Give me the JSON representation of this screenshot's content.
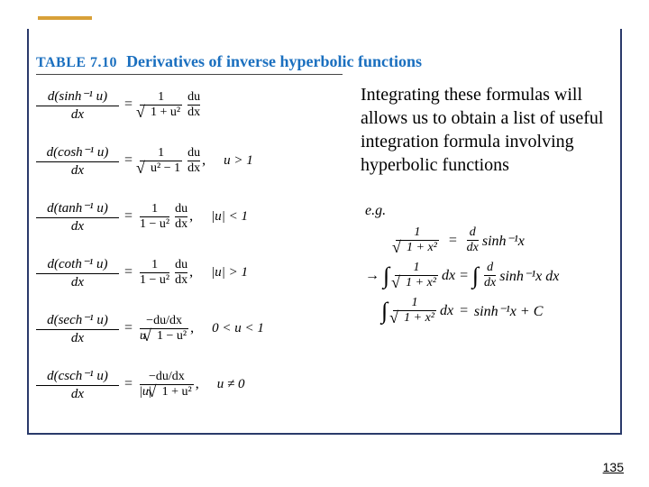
{
  "accent": {},
  "table": {
    "label": "TABLE 7.10",
    "title": "Derivatives of inverse hyperbolic functions"
  },
  "formulas": [
    {
      "lhs_num": "d(sinh⁻¹ u)",
      "lhs_den": "dx",
      "rhs_num": "1",
      "rhs_den_sqrt": "1 + u²",
      "tail": "du/dx",
      "cond": ""
    },
    {
      "lhs_num": "d(cosh⁻¹ u)",
      "lhs_den": "dx",
      "rhs_num": "1",
      "rhs_den_sqrt": "u² − 1",
      "tail": "du/dx ,",
      "cond": "u > 1"
    },
    {
      "lhs_num": "d(tanh⁻¹ u)",
      "lhs_den": "dx",
      "rhs_num": "1",
      "rhs_den_plain": "1 − u²",
      "tail": "du/dx ,",
      "cond": "|u| < 1"
    },
    {
      "lhs_num": "d(coth⁻¹ u)",
      "lhs_den": "dx",
      "rhs_num": "1",
      "rhs_den_plain": "1 − u²",
      "tail": "du/dx ,",
      "cond": "|u| > 1"
    },
    {
      "lhs_num": "d(sech⁻¹ u)",
      "lhs_den": "dx",
      "rhs_num": "−du/dx",
      "rhs_den_compound": "u√(1 − u²)",
      "tail": ",",
      "cond": "0 < u < 1"
    },
    {
      "lhs_num": "d(csch⁻¹ u)",
      "lhs_den": "dx",
      "rhs_num": "−du/dx",
      "rhs_den_compound": "|u|√(1 + u²)",
      "tail": ",",
      "cond": "u ≠ 0"
    }
  ],
  "annotation": "Integrating these formulas will allows us to obtain a list of useful integration formula involving hyperbolic functions",
  "example": {
    "label": "e.g.",
    "line1_lhs_num": "1",
    "line1_lhs_den": "√(1 + x²)",
    "line1_eq": "=",
    "line1_rhs": "d/dx sinh⁻¹x",
    "line2_arrow": "→",
    "line2_int_num": "1",
    "line2_int_den": "√(1 + x²)",
    "line2_dx": "dx",
    "line2_eq": "=",
    "line2_rhs": "∫ d/dx sinh⁻¹x dx",
    "line3_int_num": "1",
    "line3_int_den": "√(1 + x²)",
    "line3_dx": "dx",
    "line3_eq": "=",
    "line3_rhs": "sinh⁻¹x + C"
  },
  "page_number": "135"
}
